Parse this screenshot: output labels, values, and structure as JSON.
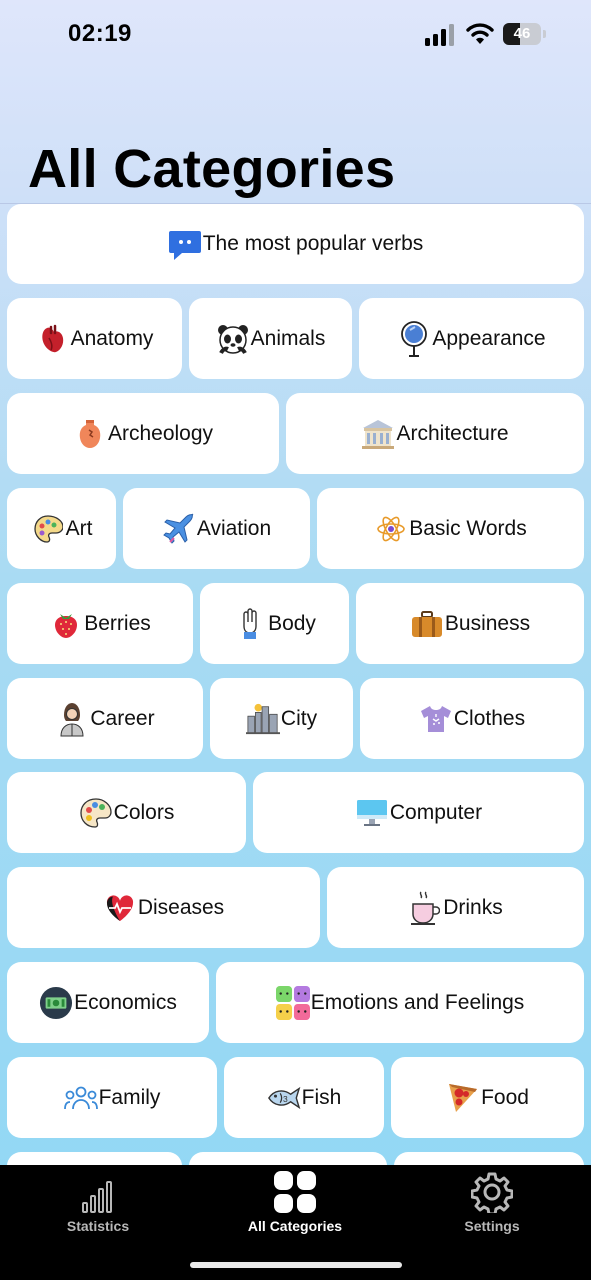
{
  "status_bar": {
    "time": "02:19",
    "battery_percent": "46",
    "battery_level": 0.46
  },
  "page_title": "All Categories",
  "categories": [
    {
      "label": "The most popular verbs",
      "icon": "speech-bubble-icon"
    },
    {
      "label": "Anatomy",
      "icon": "anatomical-heart-icon"
    },
    {
      "label": "Animals",
      "icon": "panda-icon"
    },
    {
      "label": "Appearance",
      "icon": "hand-mirror-icon"
    },
    {
      "label": "Archeology",
      "icon": "amphora-icon"
    },
    {
      "label": "Architecture",
      "icon": "classical-building-icon"
    },
    {
      "label": "Art",
      "icon": "palette-icon"
    },
    {
      "label": "Aviation",
      "icon": "airplane-icon"
    },
    {
      "label": "Basic Words",
      "icon": "atom-icon"
    },
    {
      "label": "Berries",
      "icon": "strawberry-icon"
    },
    {
      "label": "Body",
      "icon": "raised-hand-icon"
    },
    {
      "label": "Business",
      "icon": "briefcase-icon"
    },
    {
      "label": "Career",
      "icon": "businesswoman-icon"
    },
    {
      "label": "City",
      "icon": "cityscape-icon"
    },
    {
      "label": "Clothes",
      "icon": "t-shirt-icon"
    },
    {
      "label": "Colors",
      "icon": "paint-palette-icon"
    },
    {
      "label": "Computer",
      "icon": "monitor-icon"
    },
    {
      "label": "Diseases",
      "icon": "heart-pulse-icon"
    },
    {
      "label": "Drinks",
      "icon": "hot-cup-icon"
    },
    {
      "label": "Economics",
      "icon": "money-icon"
    },
    {
      "label": "Emotions and Feelings",
      "icon": "emotion-faces-icon"
    },
    {
      "label": "Family",
      "icon": "people-group-icon"
    },
    {
      "label": "Fish",
      "icon": "fish-icon"
    },
    {
      "label": "Food",
      "icon": "pizza-icon"
    }
  ],
  "tab_bar": {
    "statistics": {
      "label": "Statistics",
      "icon": "bar-chart-icon"
    },
    "all_categories": {
      "label": "All Categories",
      "icon": "grid-icon",
      "active": true
    },
    "settings": {
      "label": "Settings",
      "icon": "gear-icon"
    }
  },
  "colors": {
    "active_tab": "#ffffff",
    "inactive_tab": "#b8b8b8",
    "tab_bar_bg": "#000000",
    "card_bg": "#ffffff"
  }
}
